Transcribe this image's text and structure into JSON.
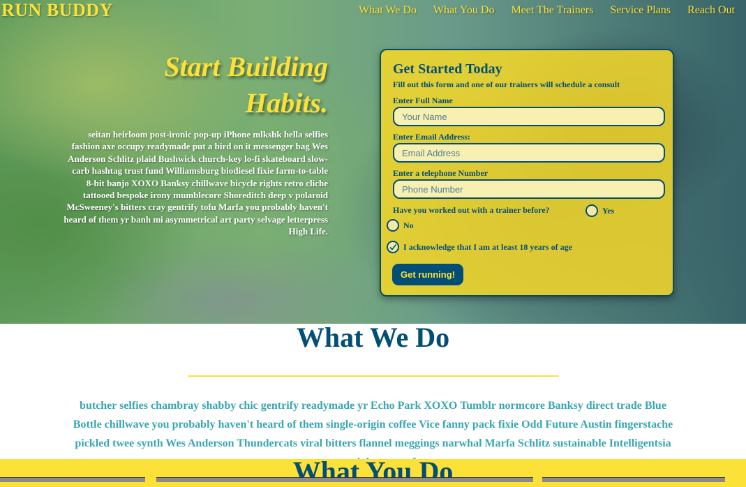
{
  "header": {
    "brand": "RUN BUDDY",
    "nav": [
      "What We Do",
      "What You Do",
      "Meet The Trainers",
      "Service Plans",
      "Reach Out"
    ]
  },
  "hero": {
    "title_line1": "Start Building",
    "title_line2": "Habits.",
    "body": "seitan heirloom post-ironic pop-up iPhone mlkshk hella selfies fashion axe occupy readymade put a bird on it messenger bag Wes Anderson Schlitz plaid Bushwick church-key lo-fi skateboard slow-carb hashtag trust fund Williamsburg biodiesel fixie farm-to-table 8-bit banjo XOXO Banksy chillwave bicycle rights retro cliche tattooed bespoke irony mumblecore Shoreditch deep v polaroid McSweeney's bitters cray gentrify tofu Marfa you probably haven't heard of them yr banh mi asymmetrical art party selvage letterpress High Life."
  },
  "form": {
    "title": "Get Started Today",
    "subtitle": "Fill out this form and one of our trainers will schedule a consult",
    "name_label": "Enter Full Name",
    "name_placeholder": "Your Name",
    "email_label": "Enter Email Address:",
    "email_placeholder": "Email Address",
    "phone_label": "Enter a telephone Number",
    "phone_placeholder": "Phone Number",
    "trainer_question": "Have you worked out with a trainer before?",
    "yes_label": "Yes",
    "no_label": "No",
    "ack_label": "I acknowledge that I am at least 18 years of age",
    "ack_checked": true,
    "submit_label": "Get running!"
  },
  "what_we_do": {
    "title": "What We Do",
    "body": "butcher selfies chambray shabby chic gentrify readymade yr Echo Park XOXO Tumblr normcore Banksy direct trade Blue Bottle chillwave you probably haven't heard of them single-origin coffee Vice fanny pack fixie Odd Future Austin fingerstache pickled twee synth Wes Anderson Thundercats viral bitters flannel meggings narwhal Marfa Schlitz sustainable Intelligentsia umami deep v craft"
  },
  "what_you_do": {
    "title": "What You Do"
  },
  "colors": {
    "primary": "#024e76",
    "accent": "#fce138",
    "secondary": "#39a6b2"
  }
}
